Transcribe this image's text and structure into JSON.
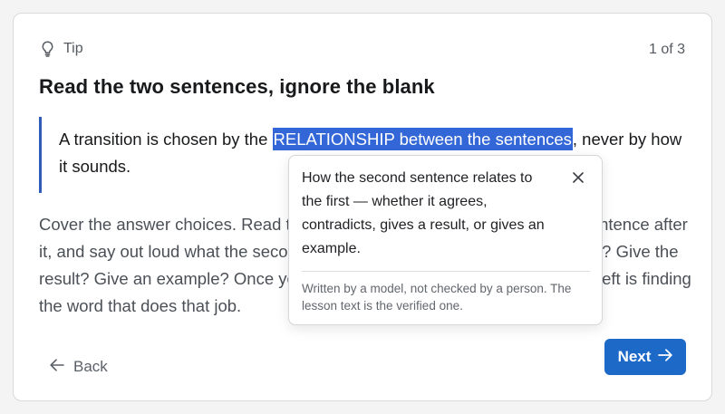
{
  "tip": {
    "icon": "lightbulb-icon",
    "label": "Tip"
  },
  "progress": "1 of 3",
  "heading": "Read the two sentences, ignore the blank",
  "quote": {
    "before": "A transition is chosen by the ",
    "highlight": "RELATIONSHIP between the sentences",
    "after": ", never by how it sounds."
  },
  "body": "Cover the answer choices. Read the sentence before the blank, then the sentence after it, and say out loud what the second one does to the first. Agree? Contradict? Give the result? Give an example? Once you can say that, the question — all that is left is finding the word that does that job.",
  "popover": {
    "text": "How the second sentence relates to the first — whether it agrees, contradicts, gives a result, or gives an example.",
    "note": "Written by a model, not checked by a person. The lesson text is the verified one."
  },
  "nav": {
    "back_label": "Back",
    "next_label": "Next"
  },
  "colors": {
    "accent": "#1d69c8",
    "highlight": "#3366d6",
    "quote_border": "#2e5cb8"
  }
}
